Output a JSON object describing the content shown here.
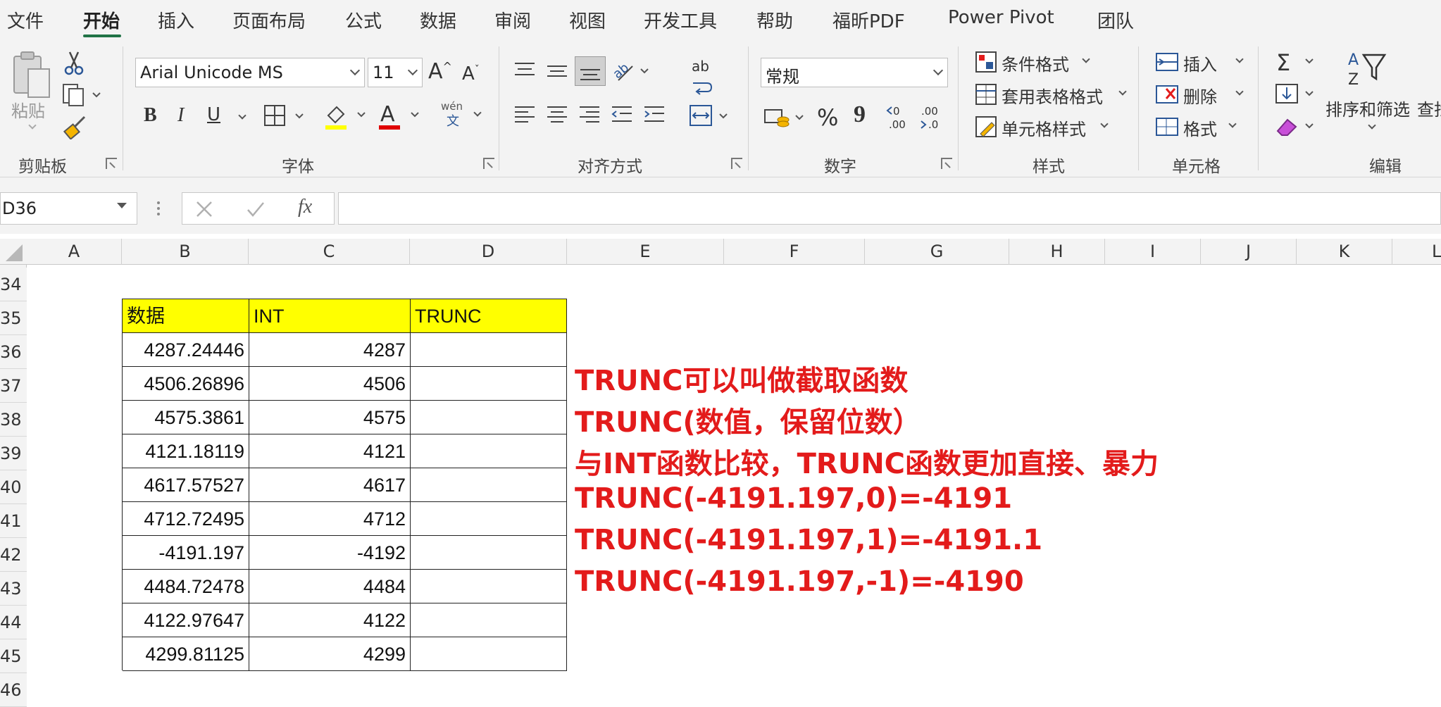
{
  "menu": {
    "tabs": [
      "文件",
      "开始",
      "插入",
      "页面布局",
      "公式",
      "数据",
      "审阅",
      "视图",
      "开发工具",
      "帮助",
      "福昕PDF",
      "Power Pivot",
      "团队"
    ],
    "active_tab": "开始"
  },
  "ribbon": {
    "clipboard": {
      "label": "剪贴板",
      "paste_label": "粘贴"
    },
    "font": {
      "label": "字体",
      "font_name": "Arial Unicode MS",
      "font_size": "11",
      "bold": "B",
      "italic": "I",
      "underline": "U",
      "phonetic": "wén",
      "phonetic_char": "文",
      "grow": "A",
      "shrink": "A",
      "font_color_glyph": "A"
    },
    "alignment": {
      "label": "对齐方式",
      "wrap_glyph": "ab"
    },
    "number": {
      "label": "数字",
      "format": "常规",
      "percent": "%",
      "comma": "9",
      "inc_decimal": "←0\n.00",
      "dec_decimal": ".00\n→.0"
    },
    "styles": {
      "label": "样式",
      "conditional": "条件格式",
      "table": "套用表格格式",
      "cell_styles": "单元格样式"
    },
    "cells": {
      "label": "单元格",
      "insert": "插入",
      "delete": "删除",
      "format": "格式"
    },
    "editing": {
      "label": "编辑",
      "sort_filter": "排序和筛选",
      "find_partial": "查找"
    }
  },
  "formula_bar": {
    "name_box": "D36",
    "formula": "",
    "fx": "fx"
  },
  "columns": [
    "A",
    "B",
    "C",
    "D",
    "E",
    "F",
    "G",
    "H",
    "I",
    "J",
    "K",
    "L"
  ],
  "rows": [
    "34",
    "35",
    "36",
    "37",
    "38",
    "39",
    "40",
    "41",
    "42",
    "43",
    "44",
    "45",
    "46"
  ],
  "table": {
    "headers": [
      "数据",
      "INT",
      "TRUNC"
    ],
    "rows": [
      [
        "4287.24446",
        "4287",
        ""
      ],
      [
        "4506.26896",
        "4506",
        ""
      ],
      [
        "4575.3861",
        "4575",
        ""
      ],
      [
        "4121.18119",
        "4121",
        ""
      ],
      [
        "4617.57527",
        "4617",
        ""
      ],
      [
        "4712.72495",
        "4712",
        ""
      ],
      [
        "-4191.197",
        "-4192",
        ""
      ],
      [
        "4484.72478",
        "4484",
        ""
      ],
      [
        "4122.97647",
        "4122",
        ""
      ],
      [
        "4299.81125",
        "4299",
        ""
      ]
    ]
  },
  "notes": [
    "TRUNC可以叫做截取函数",
    "TRUNC(数值，保留位数）",
    "与INT函数比较，TRUNC函数更加直接、暴力",
    "TRUNC(-4191.197,0)=-4191",
    "TRUNC(-4191.197,1)=-4191.1",
    "TRUNC(-4191.197,-1)=-4190"
  ],
  "colors": {
    "accent": "#217346",
    "note_red": "#e31b1b",
    "header_yellow": "#ffff00"
  }
}
